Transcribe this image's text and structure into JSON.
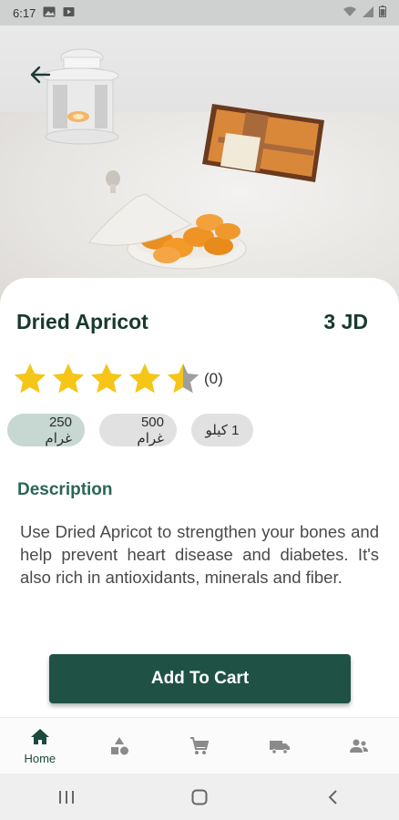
{
  "status_bar": {
    "time": "6:17"
  },
  "product": {
    "name": "Dried Apricot",
    "price": "3 JD",
    "rating_value": 4.5,
    "rating_count": "(0)",
    "stars_max": 5
  },
  "weights": [
    {
      "label": "250 غرام",
      "selected": true
    },
    {
      "label": "500 غرام",
      "selected": false
    },
    {
      "label": "1 كيلو",
      "selected": false
    }
  ],
  "description": {
    "heading": "Description",
    "text": "Use Dried Apricot to strengthen your bones and help prevent heart disease and diabetes. It's also rich in antioxidants, minerals and fiber."
  },
  "actions": {
    "add_to_cart": "Add To Cart"
  },
  "bottom_nav": {
    "items": [
      {
        "icon": "home-icon",
        "label": "Home",
        "active": true
      },
      {
        "icon": "shapes-icon",
        "label": ""
      },
      {
        "icon": "cart-icon",
        "label": ""
      },
      {
        "icon": "truck-icon",
        "label": ""
      },
      {
        "icon": "people-icon",
        "label": ""
      }
    ]
  },
  "colors": {
    "primary": "#1f5245",
    "title": "#18392f",
    "accent_heading": "#2a6657",
    "star": "#f5c518",
    "chip": "#e1e1e1",
    "chip_selected": "#c7d7d2"
  }
}
